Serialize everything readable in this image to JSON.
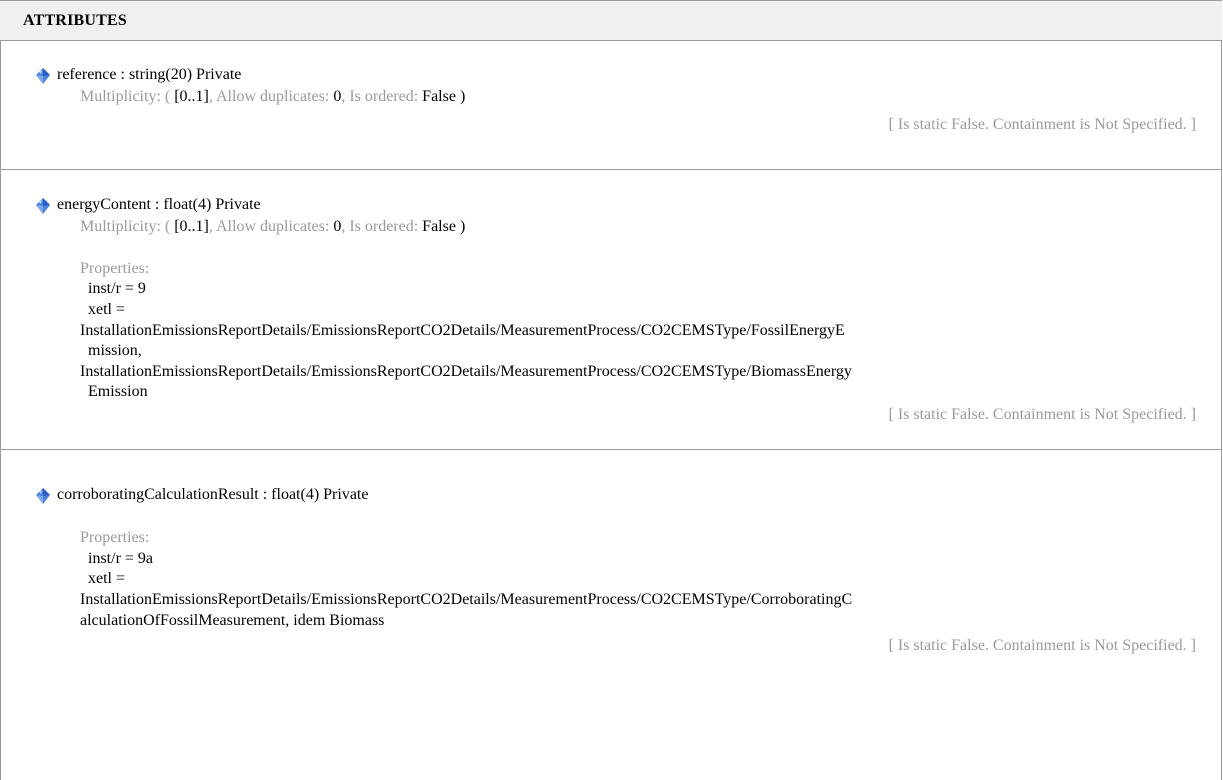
{
  "header": {
    "title": "ATTRIBUTES"
  },
  "attributes": [
    {
      "name": "reference",
      "signature": "reference : string(20)  Private",
      "multiplicity": {
        "label": "Multiplicity: (",
        "range": "[0..1]",
        "dup_label": ", Allow duplicates: ",
        "dup_value": "0",
        "ord_label": ", Is ordered: ",
        "ord_value": "False",
        "close": " )"
      },
      "static_note": "[ Is static False. Containment is Not Specified. ]"
    },
    {
      "name": "energyContent",
      "signature": "energyContent : float(4)  Private",
      "multiplicity": {
        "label": "Multiplicity: (",
        "range": "[0..1]",
        "dup_label": ", Allow duplicates: ",
        "dup_value": "0",
        "ord_label": ", Is ordered: ",
        "ord_value": "False",
        "close": " )"
      },
      "properties_label": "Properties:",
      "properties": [
        "inst/r = 9",
        "xetl =",
        "InstallationEmissionsReportDetails/EmissionsReportCO2Details/MeasurementProcess/CO2CEMSType/FossilEnergyE",
        "mission,",
        "InstallationEmissionsReportDetails/EmissionsReportCO2Details/MeasurementProcess/CO2CEMSType/BiomassEnergy",
        "Emission"
      ],
      "static_note": "[ Is static False. Containment is Not Specified. ]"
    },
    {
      "name": "corroboratingCalculationResult",
      "signature": "corroboratingCalculationResult : float(4)  Private",
      "properties_label": "Properties:",
      "properties": [
        "inst/r = 9a",
        "xetl =",
        "InstallationEmissionsReportDetails/EmissionsReportCO2Details/MeasurementProcess/CO2CEMSType/CorroboratingC",
        "alculationOfFossilMeasurement, idem Biomass"
      ],
      "static_note": "[ Is static False. Containment is Not Specified. ]"
    }
  ],
  "colors": {
    "border": "#9a9a9a",
    "header_bg": "#f0f0f0",
    "muted_text": "#9a9a9a",
    "icon_blue": "#3a6fd8"
  }
}
